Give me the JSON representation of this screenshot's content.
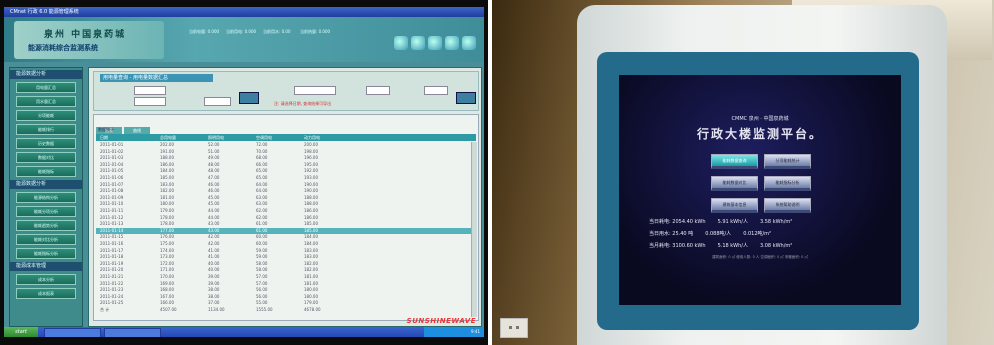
{
  "left": {
    "titlebar": "CMnet 行政 6.0 能源管理系统",
    "logo_line1": "泉州 中国泉药城",
    "logo_line2": "能源消耗综合监测系统",
    "statuses": [
      "当前电量: 0.000",
      "当前用电: 0.000",
      "当前用水: 0.00",
      "当前热量: 0.000"
    ],
    "sidebar": {
      "section1": "能源数据分析",
      "section1_items": [
        "用电量汇总",
        "用水量汇总",
        "分项能耗",
        "能耗排行",
        "历史数据",
        "数据对比",
        "能耗指标"
      ],
      "section2": "能源数据分析",
      "section2_items": [
        "能源结构分析",
        "能耗分项分析",
        "能耗趋势分析",
        "能耗对比分析",
        "能耗指标分析"
      ],
      "section3": "能源成本管理",
      "section3_items": [
        "成本分析",
        "成本报表"
      ]
    },
    "query": {
      "title": "用电量查询 - 用电量数据汇总",
      "warn": "注: 请选择日期, 查询结果可导出"
    },
    "table": {
      "tabs": [
        "报表",
        "曲线"
      ],
      "caption": "数据统计",
      "headers": [
        "日期",
        "总用电量",
        "照明用电",
        "空调用电",
        "动力用电"
      ],
      "rows": [
        [
          "2011-01-01",
          "202.00",
          "52.00",
          "72.00",
          "200.00"
        ],
        [
          "2011-01-02",
          "191.00",
          "51.00",
          "70.00",
          "198.00"
        ],
        [
          "2011-01-03",
          "188.00",
          "49.00",
          "68.00",
          "196.00"
        ],
        [
          "2011-01-04",
          "186.00",
          "48.00",
          "66.00",
          "195.00"
        ],
        [
          "2011-01-05",
          "184.00",
          "48.00",
          "65.00",
          "192.00"
        ],
        [
          "2011-01-06",
          "185.00",
          "47.00",
          "65.00",
          "193.00"
        ],
        [
          "2011-01-07",
          "183.00",
          "46.00",
          "64.00",
          "190.00"
        ],
        [
          "2011-01-08",
          "182.00",
          "46.00",
          "64.00",
          "190.00"
        ],
        [
          "2011-01-09",
          "181.00",
          "45.00",
          "63.00",
          "188.00"
        ],
        [
          "2011-01-10",
          "180.00",
          "45.00",
          "63.00",
          "188.00"
        ],
        [
          "2011-01-11",
          "179.00",
          "44.00",
          "62.00",
          "186.00"
        ],
        [
          "2011-01-12",
          "178.00",
          "44.00",
          "62.00",
          "186.00"
        ],
        [
          "2011-01-13",
          "178.00",
          "43.00",
          "61.00",
          "185.00"
        ],
        [
          "2011-01-14",
          "177.00",
          "43.00",
          "61.00",
          "185.00"
        ],
        [
          "2011-01-15",
          "176.00",
          "42.00",
          "60.00",
          "184.00"
        ],
        [
          "2011-01-16",
          "175.00",
          "42.00",
          "60.00",
          "184.00"
        ],
        [
          "2011-01-17",
          "174.00",
          "41.00",
          "59.00",
          "183.00"
        ],
        [
          "2011-01-18",
          "173.00",
          "41.00",
          "59.00",
          "183.00"
        ],
        [
          "2011-01-19",
          "172.00",
          "40.00",
          "58.00",
          "182.00"
        ],
        [
          "2011-01-20",
          "171.00",
          "40.00",
          "58.00",
          "182.00"
        ],
        [
          "2011-01-21",
          "170.00",
          "39.00",
          "57.00",
          "181.00"
        ],
        [
          "2011-01-22",
          "169.00",
          "39.00",
          "57.00",
          "181.00"
        ],
        [
          "2011-01-23",
          "168.00",
          "38.00",
          "56.00",
          "180.00"
        ],
        [
          "2011-01-24",
          "167.00",
          "38.00",
          "56.00",
          "180.00"
        ],
        [
          "2011-01-25",
          "166.00",
          "37.00",
          "55.00",
          "179.00"
        ],
        [
          "合 计",
          "4507.00",
          "1134.00",
          "1555.00",
          "4678.00"
        ]
      ],
      "selected_row": 13
    },
    "brand": "SUNSHINEWAVE",
    "taskbar": {
      "start": "start",
      "time": "9:41"
    }
  },
  "right": {
    "kiosk_title": "CMMC 泉州 · 中国泉药城",
    "kiosk_heading": "行政大楼监测平台。",
    "kiosk_buttons": [
      "能耗数据查询",
      "分项能耗统计",
      "能耗数据对比",
      "能耗指标分析",
      "建筑基本信息",
      "系统帮助说明"
    ],
    "kiosk_rows": [
      [
        "当日耗电: 2054.40 kWh",
        "5.91 kWh/人",
        "3.58 kWh/m²"
      ],
      [
        "当日用水: 25.40 吨",
        "0.088吨/人",
        "0.012吨/m²"
      ],
      [
        "当月耗电: 3100.60 kWh",
        "5.18 kWh/人",
        "3.08 kWh/m²"
      ]
    ],
    "kiosk_footer": "建筑面积: 0 ㎡  使用人数: 0 人  空调面积: 0 ㎡  采暖面积: 0 ㎡"
  }
}
